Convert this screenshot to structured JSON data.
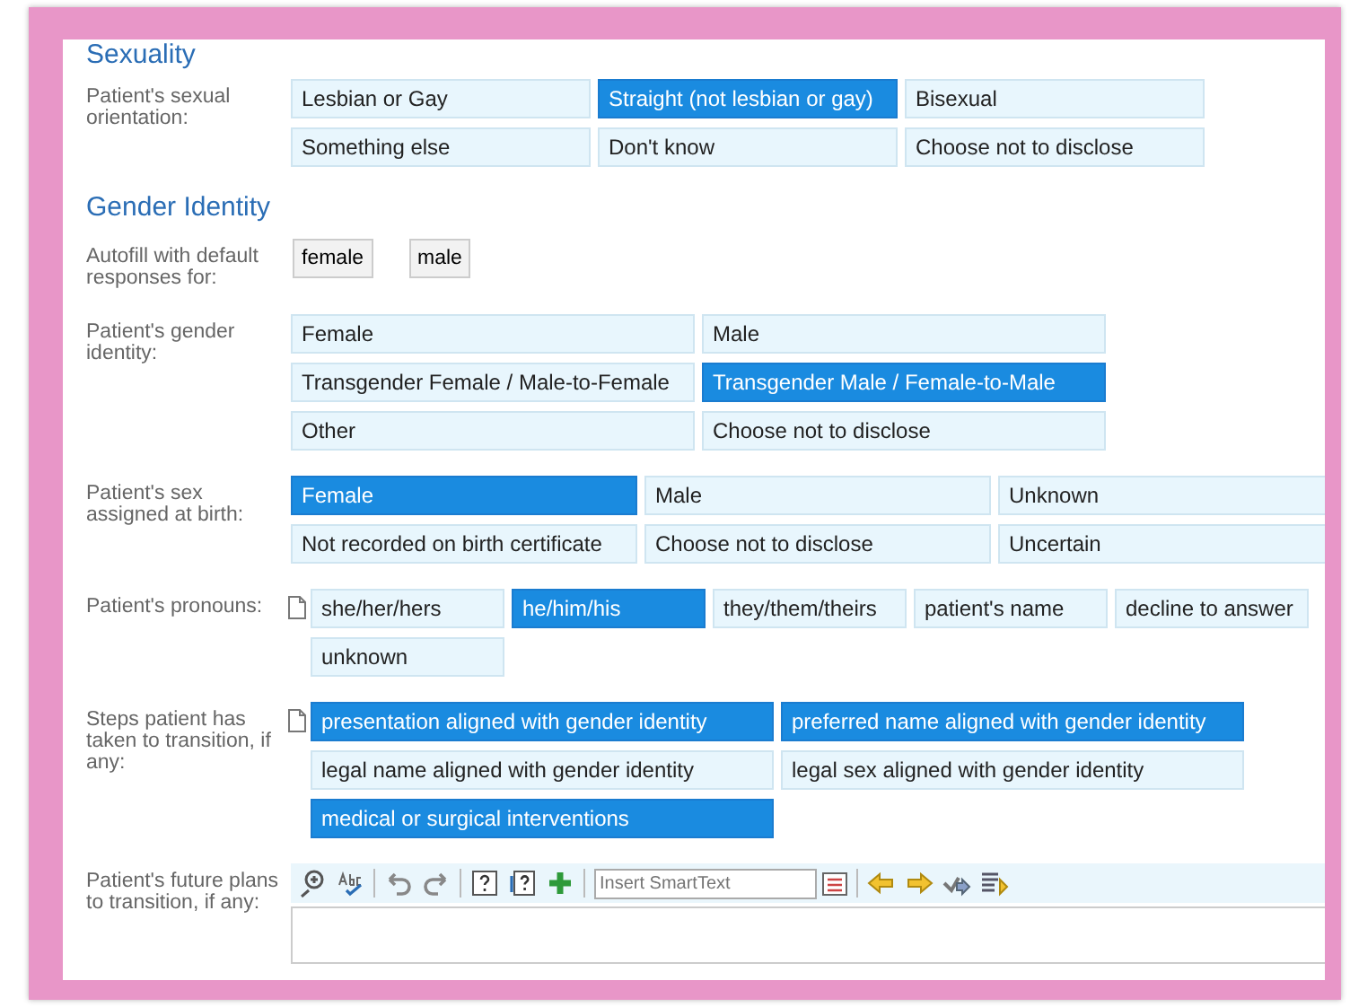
{
  "sections": [
    {
      "kind": "heading",
      "text": "Sexuality"
    },
    {
      "kind": "choices",
      "label": "Patient's sexual orientation:",
      "note_icon": false,
      "options": [
        {
          "label": "Lesbian or Gay",
          "selected": false
        },
        {
          "label": "Straight (not lesbian or gay)",
          "selected": true
        },
        {
          "label": "Bisexual",
          "selected": false
        },
        {
          "label": "Something else",
          "selected": false
        },
        {
          "label": "Don't know",
          "selected": false
        },
        {
          "label": "Choose not to disclose",
          "selected": false
        }
      ]
    },
    {
      "kind": "heading",
      "text": "Gender Identity"
    },
    {
      "kind": "autofill",
      "label": "Autofill with default responses for:",
      "buttons": [
        "female",
        "male"
      ]
    },
    {
      "kind": "choices",
      "label": "Patient's gender identity:",
      "note_icon": false,
      "options": [
        {
          "label": "Female",
          "selected": false
        },
        {
          "label": "Male",
          "selected": false
        },
        {
          "label": "Transgender Female / Male-to-Female",
          "selected": false
        },
        {
          "label": "Transgender Male / Female-to-Male",
          "selected": true
        },
        {
          "label": "Other",
          "selected": false
        },
        {
          "label": "Choose not to disclose",
          "selected": false
        }
      ]
    },
    {
      "kind": "choices",
      "label": "Patient's sex assigned at birth:",
      "note_icon": false,
      "options": [
        {
          "label": "Female",
          "selected": true
        },
        {
          "label": "Male",
          "selected": false
        },
        {
          "label": "Unknown",
          "selected": false
        },
        {
          "label": "Not recorded on birth certificate",
          "selected": false
        },
        {
          "label": "Choose not to disclose",
          "selected": false
        },
        {
          "label": "Uncertain",
          "selected": false
        }
      ]
    },
    {
      "kind": "choices",
      "label": "Patient's pronouns:",
      "note_icon": true,
      "options": [
        {
          "label": "she/her/hers",
          "selected": false
        },
        {
          "label": "he/him/his",
          "selected": true
        },
        {
          "label": "they/them/theirs",
          "selected": false
        },
        {
          "label": "patient's name",
          "selected": false
        },
        {
          "label": "decline to answer",
          "selected": false
        },
        {
          "label": "unknown",
          "selected": false
        }
      ]
    },
    {
      "kind": "choices",
      "label": "Steps patient has taken to transition, if any:",
      "note_icon": true,
      "options": [
        {
          "label": "presentation aligned with gender identity",
          "selected": true
        },
        {
          "label": "preferred name aligned with gender identity",
          "selected": true
        },
        {
          "label": "legal name aligned with gender identity",
          "selected": false
        },
        {
          "label": "legal sex aligned with gender identity",
          "selected": false
        },
        {
          "label": "medical or surgical interventions",
          "selected": true
        }
      ]
    },
    {
      "kind": "editor",
      "label": "Patient's future plans to transition, if any:",
      "placeholder": "Insert SmartText"
    }
  ]
}
